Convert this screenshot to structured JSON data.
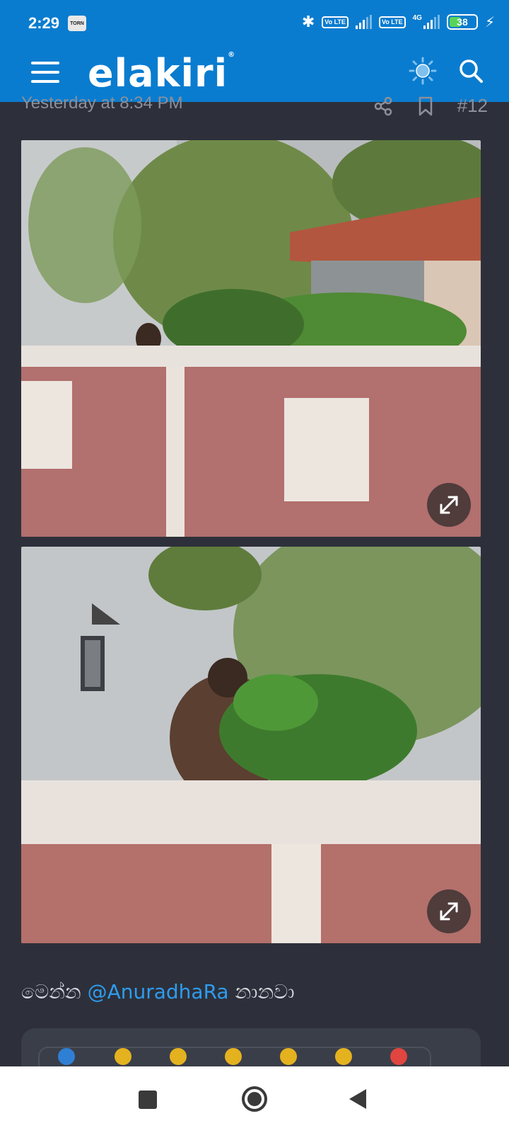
{
  "status_bar": {
    "time": "2:29",
    "notification_badge": "TORN",
    "sim1_label": "Vo LTE",
    "sim2_label": "Vo LTE",
    "network_type": "4G",
    "battery_percent": "38"
  },
  "header": {
    "logo_text": "elakiri",
    "logo_mark": "®",
    "brand_color": "#0a7ccf"
  },
  "post": {
    "date": "Yesterday at 8:34 PM",
    "number": "#12",
    "message_prefix": "මෙන්න",
    "mention": "@AnuradhaRa",
    "message_suffix": "නානවා"
  },
  "icons": {
    "menu": "hamburger-icon",
    "theme": "sun-icon",
    "search": "search-icon",
    "share": "share-icon",
    "bookmark": "bookmark-icon",
    "expand": "expand-icon"
  }
}
